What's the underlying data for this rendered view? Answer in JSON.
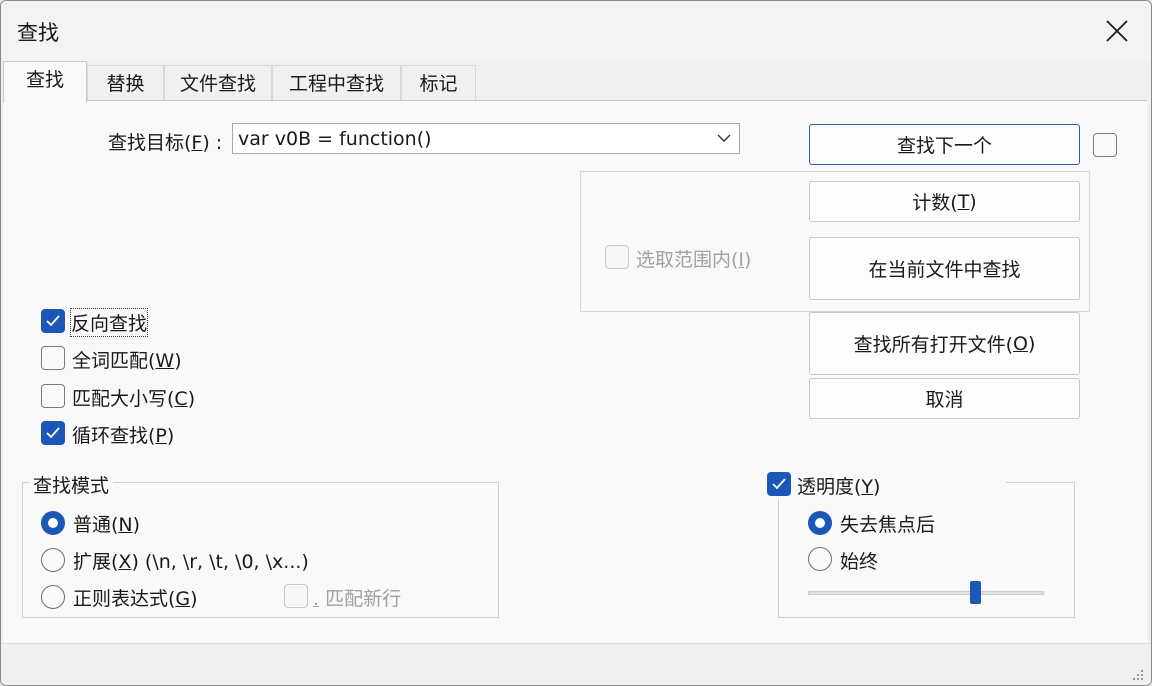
{
  "window": {
    "title": "查找"
  },
  "tabs": [
    {
      "label": "查找"
    },
    {
      "label": "替换"
    },
    {
      "label": "文件查找"
    },
    {
      "label": "工程中查找"
    },
    {
      "label": "标记"
    }
  ],
  "find": {
    "label": "查找目标(F) :",
    "label_text": "查找目标(",
    "label_key": "F",
    "label_tail": ") :",
    "value": "var v0B = function()"
  },
  "buttons": {
    "find_next": "查找下一个",
    "count_text": "计数(",
    "count_key": "T",
    "count_tail": ")",
    "find_in_current": "在当前文件中查找",
    "find_all_open_text": "查找所有打开文件(",
    "find_all_open_key": "O",
    "find_all_open_tail": ")",
    "cancel": "取消"
  },
  "in_selection": {
    "text": "选取范围内(",
    "key": "I",
    "tail": ")",
    "checked": false,
    "enabled": false
  },
  "options": {
    "reverse": {
      "label": "反向查找",
      "checked": true
    },
    "whole_word": {
      "text": "全词匹配(",
      "key": "W",
      "tail": ")",
      "checked": false
    },
    "match_case": {
      "text": "匹配大小写(",
      "key": "C",
      "tail": ")",
      "checked": false
    },
    "wrap": {
      "text": "循环查找(",
      "key": "P",
      "tail": ")",
      "checked": true
    }
  },
  "search_mode": {
    "title": "查找模式",
    "normal": {
      "text": "普通(",
      "key": "N",
      "tail": ")",
      "selected": true
    },
    "extended": {
      "text": "扩展(",
      "key": "X",
      "tail": ") (\\n, \\r, \\t, \\0, \\x...)",
      "selected": false
    },
    "regex": {
      "text": "正则表达式(",
      "key": "G",
      "tail": ")",
      "selected": false
    },
    "dot_newline": {
      "key": ".",
      "text": " 匹配新行",
      "checked": false,
      "enabled": false
    }
  },
  "transparency": {
    "text": "透明度(",
    "key": "Y",
    "tail": ")",
    "checked": true,
    "on_lose_focus": {
      "label": "失去焦点后",
      "selected": true
    },
    "always": {
      "label": "始终",
      "selected": false
    },
    "level": 0.7
  },
  "colors": {
    "accent": "#1a57b6"
  }
}
